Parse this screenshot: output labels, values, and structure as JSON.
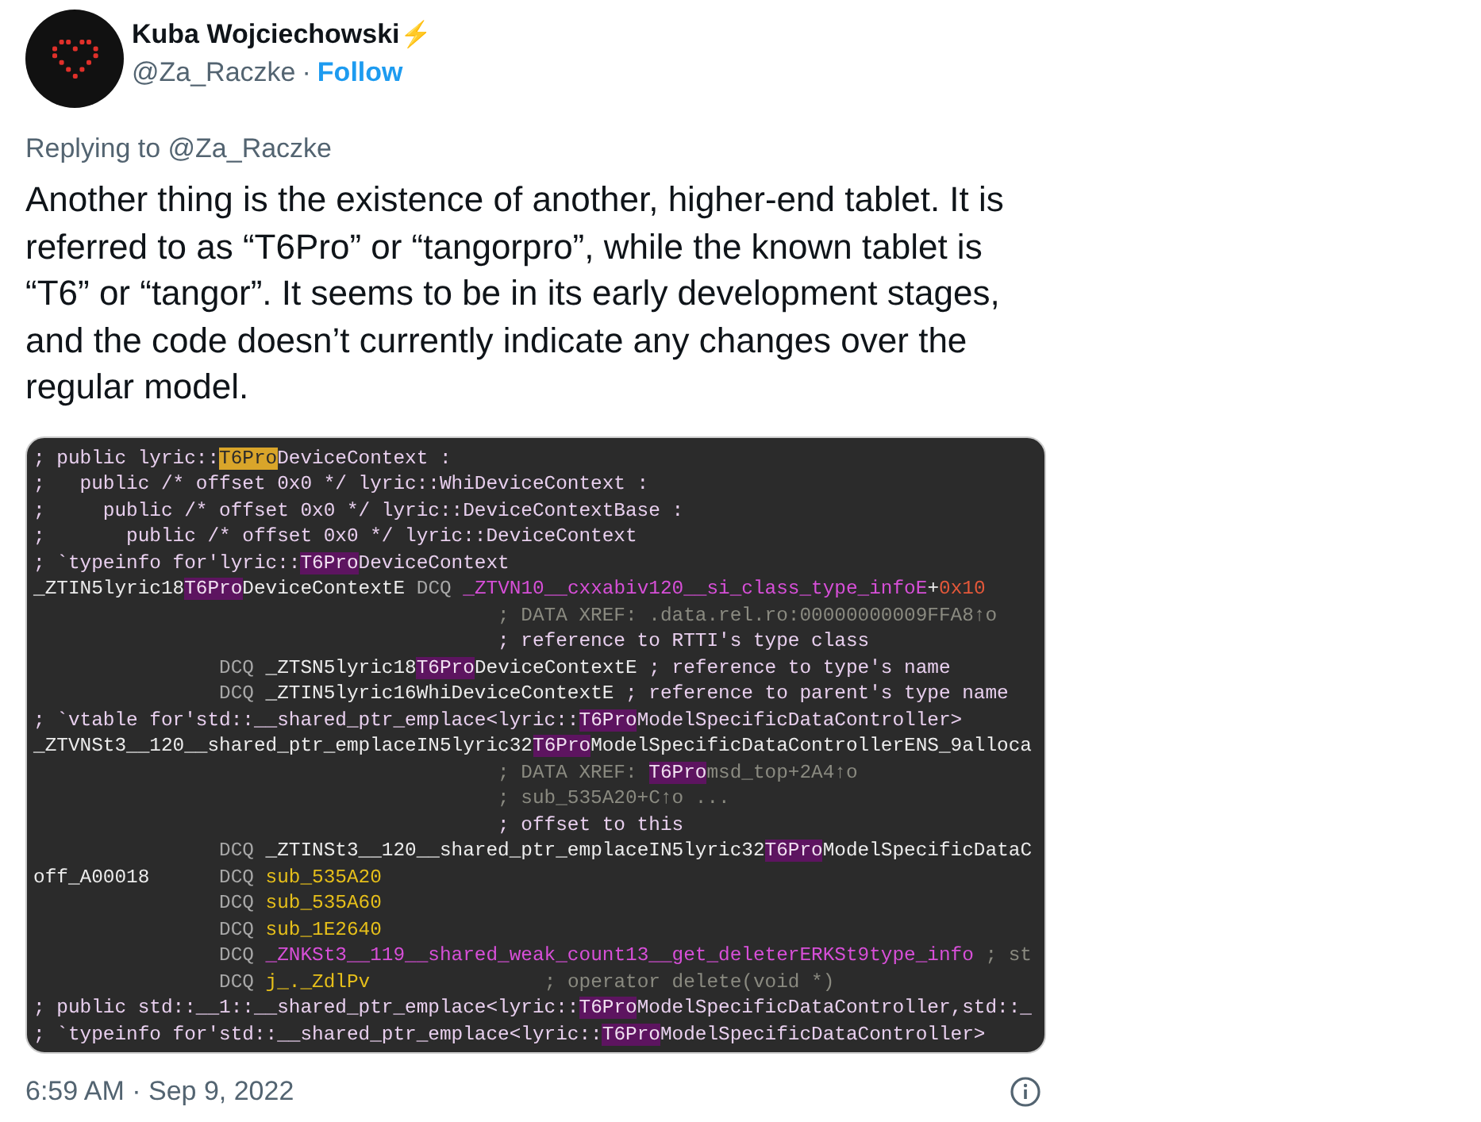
{
  "author": {
    "name": "Kuba Wojciechowski",
    "badge": "⚡",
    "handle": "@Za_Raczke",
    "separator": "·",
    "follow": "Follow"
  },
  "replying_to": "Replying to @Za_Raczke",
  "text": "Another thing is the existence of another, higher-end tablet. It is referred to as “T6Pro” or “tangorpro”, while the known tablet is “T6” or “tangor”. It seems to be in its early development stages, and the code doesn’t currently indicate any changes over the regular model.",
  "code_image": {
    "lines": [
      [
        {
          "kind": "note",
          "text": "; public lyric::"
        },
        {
          "kind": "mark-alt",
          "text": "T6Pro"
        },
        {
          "kind": "note",
          "text": "DeviceContext :"
        }
      ],
      [
        {
          "kind": "note",
          "text": ";   public /* offset 0x0 */ lyric::WhiDeviceContext :"
        }
      ],
      [
        {
          "kind": "note",
          "text": ";     public /* offset 0x0 */ lyric::DeviceContextBase :"
        }
      ],
      [
        {
          "kind": "note",
          "text": ";       public /* offset 0x0 */ lyric::DeviceContext"
        }
      ],
      [
        {
          "kind": "note",
          "text": "; `typeinfo for'lyric::"
        },
        {
          "kind": "mark",
          "text": "T6Pro"
        },
        {
          "kind": "note",
          "text": "DeviceContext"
        }
      ],
      [
        {
          "kind": "plain",
          "text": "_ZTIN5lyric18"
        },
        {
          "kind": "mark",
          "text": "T6Pro"
        },
        {
          "kind": "plain",
          "text": "DeviceContextE "
        },
        {
          "kind": "op",
          "text": "DCQ "
        },
        {
          "kind": "symbol",
          "text": "_ZTVN10__cxxabiv120__si_class_type_infoE"
        },
        {
          "kind": "plain",
          "text": "+"
        },
        {
          "kind": "num",
          "text": "0x10"
        }
      ],
      [
        {
          "kind": "dim",
          "text": "                                        ; DATA XREF: .data.rel.ro:00000000009FFA8↑o"
        }
      ],
      [
        {
          "kind": "note",
          "text": "                                        ; reference to RTTI's type class"
        }
      ],
      [
        {
          "kind": "op",
          "text": "                DCQ "
        },
        {
          "kind": "plain",
          "text": "_ZTSN5lyric18"
        },
        {
          "kind": "mark",
          "text": "T6Pro"
        },
        {
          "kind": "plain",
          "text": "DeviceContextE "
        },
        {
          "kind": "note",
          "text": "; reference to type's name"
        }
      ],
      [
        {
          "kind": "op",
          "text": "                DCQ "
        },
        {
          "kind": "plain",
          "text": "_ZTIN5lyric16WhiDeviceContextE "
        },
        {
          "kind": "note",
          "text": "; reference to parent's type name"
        }
      ],
      [
        {
          "kind": "note",
          "text": "; `vtable for'std::__shared_ptr_emplace<lyric::"
        },
        {
          "kind": "mark",
          "text": "T6Pro"
        },
        {
          "kind": "note",
          "text": "ModelSpecificDataController>"
        }
      ],
      [
        {
          "kind": "plain",
          "text": "_ZTVNSt3__120__shared_ptr_emplaceIN5lyric32"
        },
        {
          "kind": "mark",
          "text": "T6Pro"
        },
        {
          "kind": "plain",
          "text": "ModelSpecificDataControllerENS_9alloca"
        }
      ],
      [
        {
          "kind": "dim",
          "text": "                                        ; DATA XREF: "
        },
        {
          "kind": "mark",
          "text": "T6Pro"
        },
        {
          "kind": "dim",
          "text": "msd_top+2A4↑o"
        }
      ],
      [
        {
          "kind": "dim",
          "text": "                                        ; sub_535A20+C↑o ..."
        }
      ],
      [
        {
          "kind": "note",
          "text": "                                        ; offset to this"
        }
      ],
      [
        {
          "kind": "op",
          "text": "                DCQ "
        },
        {
          "kind": "plain",
          "text": "_ZTINSt3__120__shared_ptr_emplaceIN5lyric32"
        },
        {
          "kind": "mark",
          "text": "T6Pro"
        },
        {
          "kind": "plain",
          "text": "ModelSpecificDataC"
        }
      ],
      [
        {
          "kind": "plain",
          "text": "off_A00018      "
        },
        {
          "kind": "op",
          "text": "DCQ "
        },
        {
          "kind": "sub",
          "text": "sub_535A20"
        }
      ],
      [
        {
          "kind": "op",
          "text": "                DCQ "
        },
        {
          "kind": "sub",
          "text": "sub_535A60"
        }
      ],
      [
        {
          "kind": "op",
          "text": "                DCQ "
        },
        {
          "kind": "sub",
          "text": "sub_1E2640"
        }
      ],
      [
        {
          "kind": "op",
          "text": "                DCQ "
        },
        {
          "kind": "symbol",
          "text": "_ZNKSt3__119__shared_weak_count13__get_deleterERKSt9type_info"
        },
        {
          "kind": "dim",
          "text": " ; st"
        }
      ],
      [
        {
          "kind": "op",
          "text": "                DCQ "
        },
        {
          "kind": "sub",
          "text": "j_._ZdlPv"
        },
        {
          "kind": "dim",
          "text": "               ; operator delete(void *)"
        }
      ],
      [
        {
          "kind": "note",
          "text": "; public std::__1::__shared_ptr_emplace<lyric::"
        },
        {
          "kind": "mark",
          "text": "T6Pro"
        },
        {
          "kind": "note",
          "text": "ModelSpecificDataController,std::_"
        }
      ],
      [
        {
          "kind": "note",
          "text": "; `typeinfo for'std::__shared_ptr_emplace<lyric::"
        },
        {
          "kind": "mark",
          "text": "T6Pro"
        },
        {
          "kind": "note",
          "text": "ModelSpecificDataController>"
        }
      ]
    ]
  },
  "timestamp": "6:59 AM · Sep 9, 2022"
}
